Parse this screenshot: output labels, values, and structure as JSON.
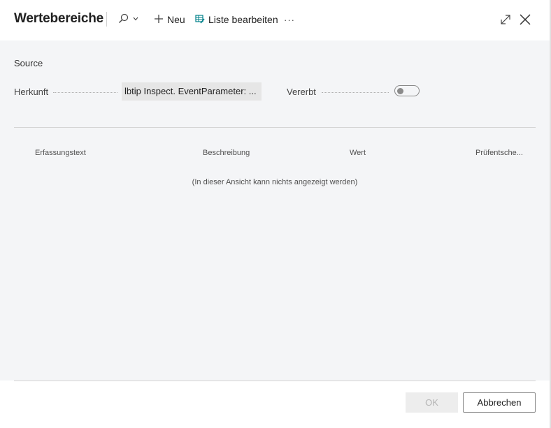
{
  "header": {
    "title": "Wertebereiche",
    "toolbar": {
      "search_icon": "search-icon",
      "new_label": "Neu",
      "edit_list_label": "Liste bearbeiten",
      "more_label": "···"
    },
    "window": {
      "expand_icon": "expand-icon",
      "close_icon": "close-icon"
    }
  },
  "section": {
    "title": "Source",
    "fields": {
      "herkunft_label": "Herkunft",
      "herkunft_value": "lbtip Inspect. EventParameter: ...",
      "vererbt_label": "Vererbt",
      "vererbt_on": false
    }
  },
  "table": {
    "columns": [
      "Erfassungstext",
      "Beschreibung",
      "Wert",
      "Prüfentsche..."
    ],
    "empty_message": "(In dieser Ansicht kann nichts angezeigt werden)"
  },
  "footer": {
    "ok_label": "OK",
    "cancel_label": "Abbrechen"
  },
  "colors": {
    "accent_teal": "#00818a",
    "content_bg": "#f4f5f7",
    "text": "#212121"
  }
}
